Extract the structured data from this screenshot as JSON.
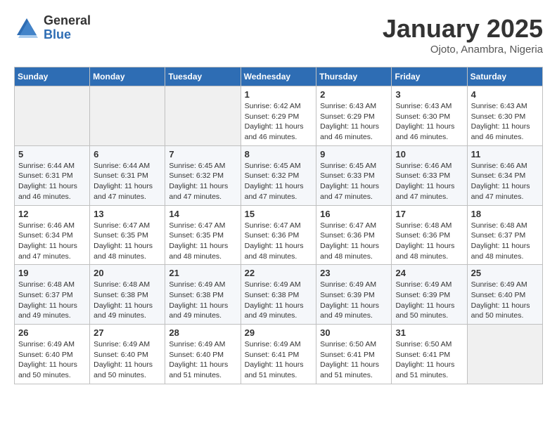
{
  "header": {
    "logo_general": "General",
    "logo_blue": "Blue",
    "month_title": "January 2025",
    "location": "Ojoto, Anambra, Nigeria"
  },
  "days_of_week": [
    "Sunday",
    "Monday",
    "Tuesday",
    "Wednesday",
    "Thursday",
    "Friday",
    "Saturday"
  ],
  "weeks": [
    [
      {
        "day": "",
        "info": ""
      },
      {
        "day": "",
        "info": ""
      },
      {
        "day": "",
        "info": ""
      },
      {
        "day": "1",
        "info": "Sunrise: 6:42 AM\nSunset: 6:29 PM\nDaylight: 11 hours and 46 minutes."
      },
      {
        "day": "2",
        "info": "Sunrise: 6:43 AM\nSunset: 6:29 PM\nDaylight: 11 hours and 46 minutes."
      },
      {
        "day": "3",
        "info": "Sunrise: 6:43 AM\nSunset: 6:30 PM\nDaylight: 11 hours and 46 minutes."
      },
      {
        "day": "4",
        "info": "Sunrise: 6:43 AM\nSunset: 6:30 PM\nDaylight: 11 hours and 46 minutes."
      }
    ],
    [
      {
        "day": "5",
        "info": "Sunrise: 6:44 AM\nSunset: 6:31 PM\nDaylight: 11 hours and 46 minutes."
      },
      {
        "day": "6",
        "info": "Sunrise: 6:44 AM\nSunset: 6:31 PM\nDaylight: 11 hours and 47 minutes."
      },
      {
        "day": "7",
        "info": "Sunrise: 6:45 AM\nSunset: 6:32 PM\nDaylight: 11 hours and 47 minutes."
      },
      {
        "day": "8",
        "info": "Sunrise: 6:45 AM\nSunset: 6:32 PM\nDaylight: 11 hours and 47 minutes."
      },
      {
        "day": "9",
        "info": "Sunrise: 6:45 AM\nSunset: 6:33 PM\nDaylight: 11 hours and 47 minutes."
      },
      {
        "day": "10",
        "info": "Sunrise: 6:46 AM\nSunset: 6:33 PM\nDaylight: 11 hours and 47 minutes."
      },
      {
        "day": "11",
        "info": "Sunrise: 6:46 AM\nSunset: 6:34 PM\nDaylight: 11 hours and 47 minutes."
      }
    ],
    [
      {
        "day": "12",
        "info": "Sunrise: 6:46 AM\nSunset: 6:34 PM\nDaylight: 11 hours and 47 minutes."
      },
      {
        "day": "13",
        "info": "Sunrise: 6:47 AM\nSunset: 6:35 PM\nDaylight: 11 hours and 48 minutes."
      },
      {
        "day": "14",
        "info": "Sunrise: 6:47 AM\nSunset: 6:35 PM\nDaylight: 11 hours and 48 minutes."
      },
      {
        "day": "15",
        "info": "Sunrise: 6:47 AM\nSunset: 6:36 PM\nDaylight: 11 hours and 48 minutes."
      },
      {
        "day": "16",
        "info": "Sunrise: 6:47 AM\nSunset: 6:36 PM\nDaylight: 11 hours and 48 minutes."
      },
      {
        "day": "17",
        "info": "Sunrise: 6:48 AM\nSunset: 6:36 PM\nDaylight: 11 hours and 48 minutes."
      },
      {
        "day": "18",
        "info": "Sunrise: 6:48 AM\nSunset: 6:37 PM\nDaylight: 11 hours and 48 minutes."
      }
    ],
    [
      {
        "day": "19",
        "info": "Sunrise: 6:48 AM\nSunset: 6:37 PM\nDaylight: 11 hours and 49 minutes."
      },
      {
        "day": "20",
        "info": "Sunrise: 6:48 AM\nSunset: 6:38 PM\nDaylight: 11 hours and 49 minutes."
      },
      {
        "day": "21",
        "info": "Sunrise: 6:49 AM\nSunset: 6:38 PM\nDaylight: 11 hours and 49 minutes."
      },
      {
        "day": "22",
        "info": "Sunrise: 6:49 AM\nSunset: 6:38 PM\nDaylight: 11 hours and 49 minutes."
      },
      {
        "day": "23",
        "info": "Sunrise: 6:49 AM\nSunset: 6:39 PM\nDaylight: 11 hours and 49 minutes."
      },
      {
        "day": "24",
        "info": "Sunrise: 6:49 AM\nSunset: 6:39 PM\nDaylight: 11 hours and 50 minutes."
      },
      {
        "day": "25",
        "info": "Sunrise: 6:49 AM\nSunset: 6:40 PM\nDaylight: 11 hours and 50 minutes."
      }
    ],
    [
      {
        "day": "26",
        "info": "Sunrise: 6:49 AM\nSunset: 6:40 PM\nDaylight: 11 hours and 50 minutes."
      },
      {
        "day": "27",
        "info": "Sunrise: 6:49 AM\nSunset: 6:40 PM\nDaylight: 11 hours and 50 minutes."
      },
      {
        "day": "28",
        "info": "Sunrise: 6:49 AM\nSunset: 6:40 PM\nDaylight: 11 hours and 51 minutes."
      },
      {
        "day": "29",
        "info": "Sunrise: 6:49 AM\nSunset: 6:41 PM\nDaylight: 11 hours and 51 minutes."
      },
      {
        "day": "30",
        "info": "Sunrise: 6:50 AM\nSunset: 6:41 PM\nDaylight: 11 hours and 51 minutes."
      },
      {
        "day": "31",
        "info": "Sunrise: 6:50 AM\nSunset: 6:41 PM\nDaylight: 11 hours and 51 minutes."
      },
      {
        "day": "",
        "info": ""
      }
    ]
  ]
}
